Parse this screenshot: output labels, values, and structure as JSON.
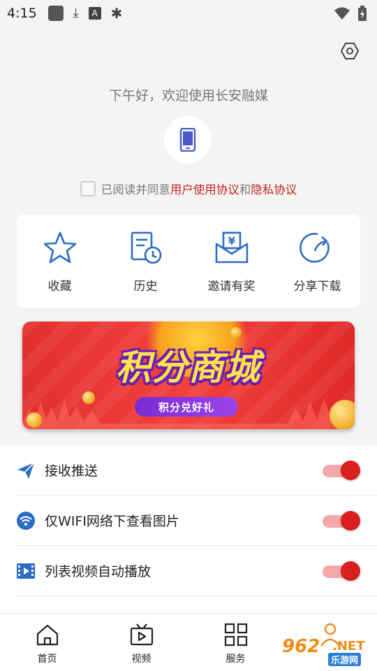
{
  "status_bar": {
    "time": "4:15",
    "icons_left": [
      "app-square-icon",
      "download-icon",
      "a-icon",
      "bug-icon"
    ],
    "icons_right": [
      "wifi-icon",
      "battery-icon"
    ]
  },
  "header": {
    "greeting": "下午好，欢迎使用长安融媒"
  },
  "agreement": {
    "prefix": "已阅读并同意",
    "user_agreement": "用户使用协议",
    "and": "和",
    "privacy": "隐私协议"
  },
  "quick_actions": [
    {
      "label": "收藏",
      "icon": "star-icon"
    },
    {
      "label": "历史",
      "icon": "history-icon"
    },
    {
      "label": "邀请有奖",
      "icon": "invite-icon"
    },
    {
      "label": "分享下载",
      "icon": "share-icon"
    }
  ],
  "banner": {
    "title": "积分商城",
    "subtitle": "积分兑好礼"
  },
  "settings": [
    {
      "label": "接收推送",
      "icon": "send-icon",
      "on": true
    },
    {
      "label": "仅WIFI网络下查看图片",
      "icon": "wifi-circle-icon",
      "on": true
    },
    {
      "label": "列表视频自动播放",
      "icon": "video-icon",
      "on": true
    }
  ],
  "bottom_nav": [
    {
      "label": "首页",
      "icon": "home-icon"
    },
    {
      "label": "视频",
      "icon": "tv-icon"
    },
    {
      "label": "服务",
      "icon": "grid-icon"
    },
    {
      "label": "",
      "icon": "user-icon"
    }
  ],
  "watermark": {
    "num": "962",
    "net": ".NET",
    "cn": "乐游网"
  },
  "colors": {
    "accent_red": "#c52222",
    "toggle_on": "#d9201f",
    "icon_blue": "#2b6cc4"
  }
}
